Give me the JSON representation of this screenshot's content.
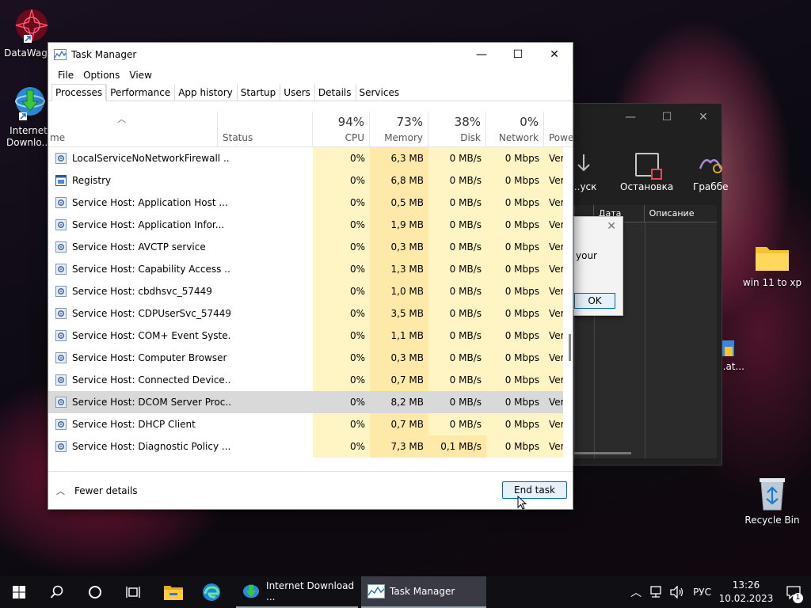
{
  "desktop": {
    "icons": [
      {
        "label": "DataWagon"
      },
      {
        "label_line1": "Internet",
        "label_line2": "Downlo..."
      },
      {
        "label": "win 11 to xp"
      },
      {
        "label": "Recycle Bin"
      },
      {
        "label": "...at..."
      }
    ]
  },
  "bg_window": {
    "tool1": "...уск",
    "tool2": "Остановка",
    "tool3": "Граббе",
    "col1": "Дата по...",
    "col2": "Описание"
  },
  "dialog": {
    "text": "your",
    "ok_label": "OK"
  },
  "task_manager": {
    "title": "Task Manager",
    "menu": [
      "File",
      "Options",
      "View"
    ],
    "tabs": [
      "Processes",
      "Performance",
      "App history",
      "Startup",
      "Users",
      "Details",
      "Services"
    ],
    "active_tab": "Processes",
    "columns": {
      "name": "me",
      "status": "Status",
      "cpu": {
        "pct": "94%",
        "label": "CPU"
      },
      "memory": {
        "pct": "73%",
        "label": "Memory"
      },
      "disk": {
        "pct": "38%",
        "label": "Disk"
      },
      "network": {
        "pct": "0%",
        "label": "Network"
      },
      "power": "Powe"
    },
    "rows": [
      {
        "name": "LocalServiceNoNetworkFirewall ...",
        "cpu": "0%",
        "mem": "6,3 MB",
        "disk": "0 MB/s",
        "net": "0 Mbps",
        "power": "Ver",
        "icon": "gear-icon"
      },
      {
        "name": "Registry",
        "cpu": "0%",
        "mem": "6,8 MB",
        "disk": "0 MB/s",
        "net": "0 Mbps",
        "power": "Ver",
        "icon": "window-icon"
      },
      {
        "name": "Service Host: Application Host ...",
        "cpu": "0%",
        "mem": "0,5 MB",
        "disk": "0 MB/s",
        "net": "0 Mbps",
        "power": "Ver",
        "icon": "gear-icon"
      },
      {
        "name": "Service Host: Application Infor...",
        "cpu": "0%",
        "mem": "1,9 MB",
        "disk": "0 MB/s",
        "net": "0 Mbps",
        "power": "Ver",
        "icon": "gear-icon"
      },
      {
        "name": "Service Host: AVCTP service",
        "cpu": "0%",
        "mem": "0,3 MB",
        "disk": "0 MB/s",
        "net": "0 Mbps",
        "power": "Ver",
        "icon": "gear-icon"
      },
      {
        "name": "Service Host: Capability Access ...",
        "cpu": "0%",
        "mem": "1,3 MB",
        "disk": "0 MB/s",
        "net": "0 Mbps",
        "power": "Ver",
        "icon": "gear-icon"
      },
      {
        "name": "Service Host: cbdhsvc_57449",
        "cpu": "0%",
        "mem": "1,0 MB",
        "disk": "0 MB/s",
        "net": "0 Mbps",
        "power": "Ver",
        "icon": "gear-icon"
      },
      {
        "name": "Service Host: CDPUserSvc_57449",
        "cpu": "0%",
        "mem": "3,5 MB",
        "disk": "0 MB/s",
        "net": "0 Mbps",
        "power": "Ver",
        "icon": "gear-icon"
      },
      {
        "name": "Service Host: COM+ Event Syste...",
        "cpu": "0%",
        "mem": "1,1 MB",
        "disk": "0 MB/s",
        "net": "0 Mbps",
        "power": "Ver",
        "icon": "gear-icon"
      },
      {
        "name": "Service Host: Computer Browser",
        "cpu": "0%",
        "mem": "0,3 MB",
        "disk": "0 MB/s",
        "net": "0 Mbps",
        "power": "Ver",
        "icon": "gear-icon"
      },
      {
        "name": "Service Host: Connected Device...",
        "cpu": "0%",
        "mem": "0,7 MB",
        "disk": "0 MB/s",
        "net": "0 Mbps",
        "power": "Ver",
        "icon": "gear-icon"
      },
      {
        "name": "Service Host: DCOM Server Proc...",
        "cpu": "0%",
        "mem": "8,2 MB",
        "disk": "0 MB/s",
        "net": "0 Mbps",
        "power": "Ver",
        "icon": "gear-icon",
        "selected": true
      },
      {
        "name": "Service Host: DHCP Client",
        "cpu": "0%",
        "mem": "0,7 MB",
        "disk": "0 MB/s",
        "net": "0 Mbps",
        "power": "Ver",
        "icon": "gear-icon"
      },
      {
        "name": "Service Host: Diagnostic Policy ...",
        "cpu": "0%",
        "mem": "7,3 MB",
        "disk": "0,1 MB/s",
        "net": "0 Mbps",
        "power": "Ver",
        "icon": "gear-icon",
        "disk_heat": true
      }
    ],
    "fewer_details": "Fewer details",
    "end_task": "End task"
  },
  "taskbar": {
    "apps": [
      {
        "label": "Internet Download ..."
      },
      {
        "label": "Task Manager"
      }
    ],
    "language": "РУС",
    "time": "13:26",
    "date": "10.02.2023",
    "notifications": "1"
  }
}
